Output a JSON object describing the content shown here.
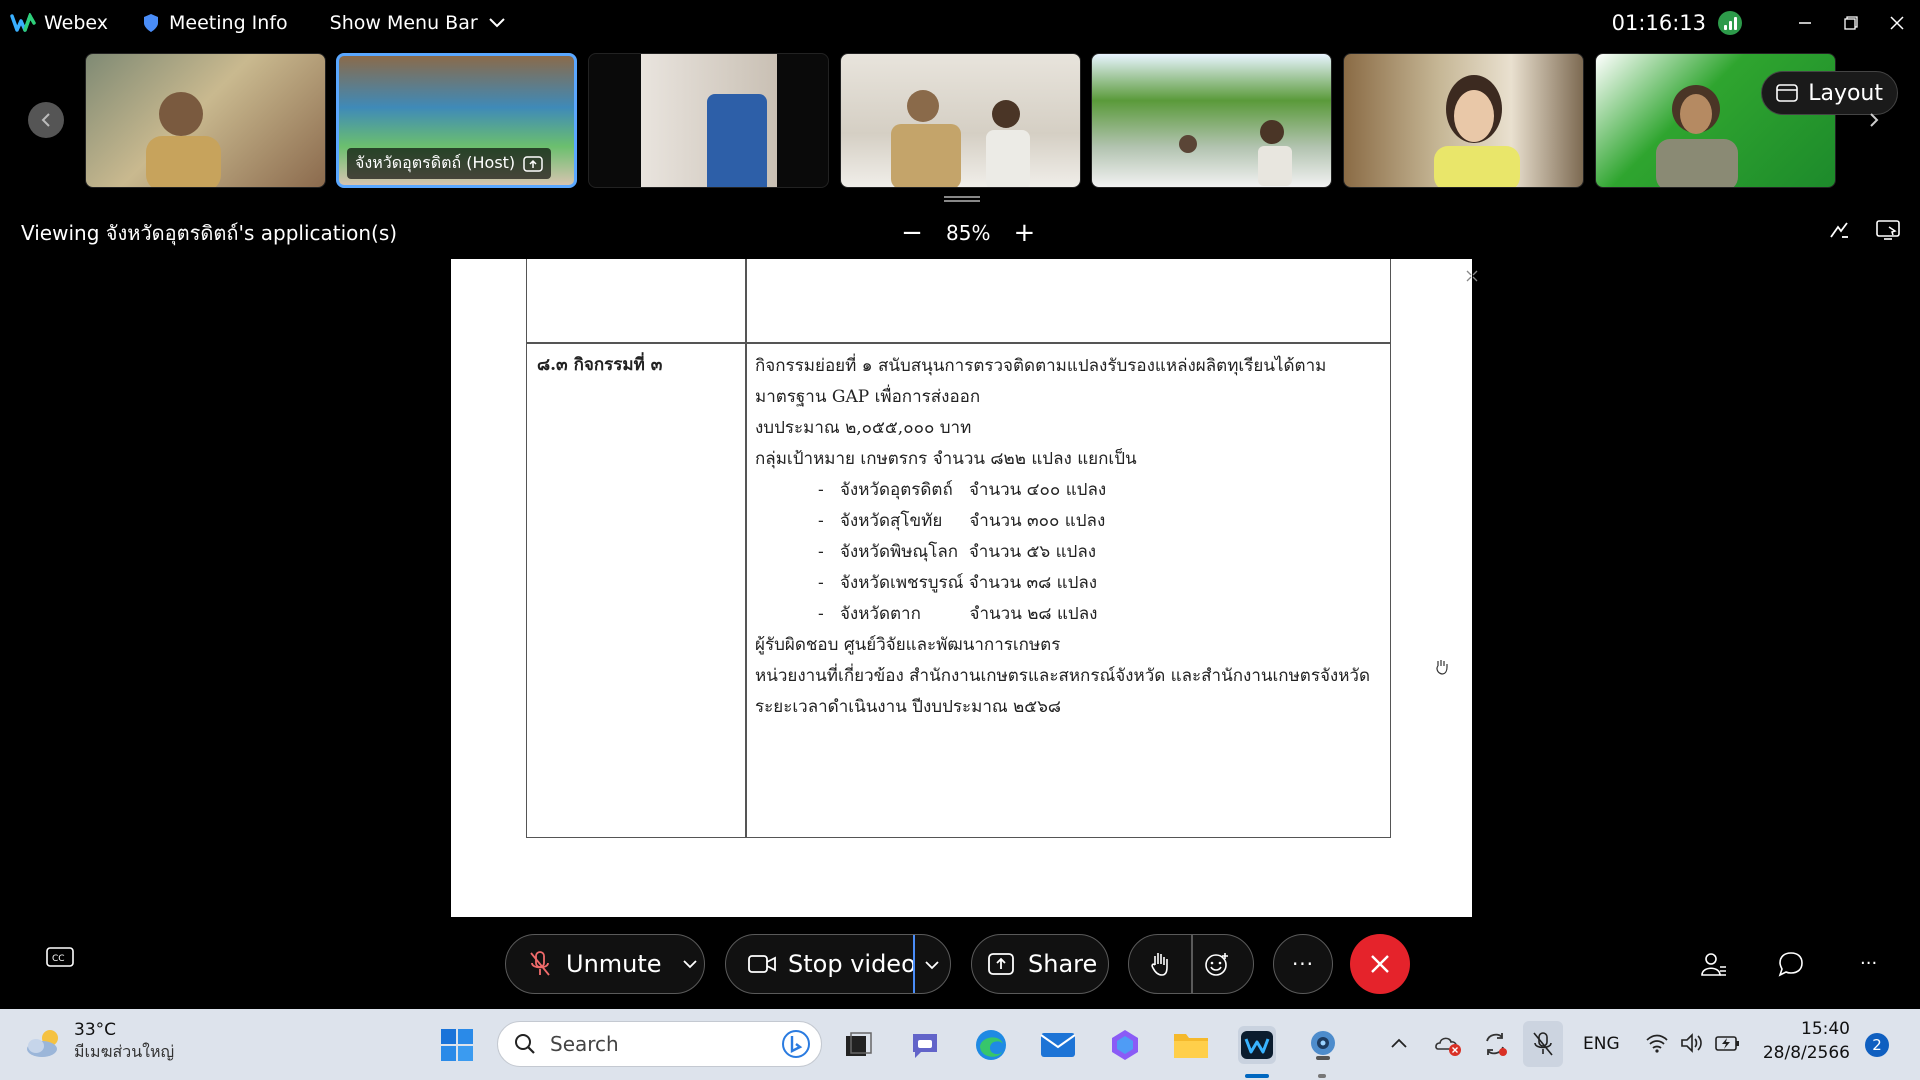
{
  "topbar": {
    "app_name": "Webex",
    "meeting_info": "Meeting Info",
    "show_menu_bar": "Show Menu Bar",
    "clock": "01:16:13"
  },
  "strip": {
    "host_label": "จังหวัดอุตรดิตถ์ (Host)",
    "layout_label": "Layout"
  },
  "viewbar": {
    "viewing_text": "Viewing จังหวัดอุตรดิตถ์'s application(s)",
    "zoom_minus": "−",
    "zoom_level": "85%",
    "zoom_plus": "+"
  },
  "document": {
    "left_cell": "๘.๓ กิจกรรมที่ ๓",
    "lines": [
      "กิจกรรมย่อยที่ ๑ สนับสนุนการตรวจติดตามแปลงรับรองแหล่งผลิตทุเรียนได้ตาม",
      "มาตรฐาน GAP เพื่อการส่งออก",
      "งบประมาณ  ๒,๐๕๕,๐๐๐  บาท",
      "กลุ่มเป้าหมาย เกษตรกร จำนวน ๘๒๒ แปลง แยกเป็น"
    ],
    "bullets": [
      "-   จังหวัดอุตรดิตถ์   จำนวน ๔๐๐ แปลง",
      "-   จังหวัดสุโขทัย     จำนวน ๓๐๐ แปลง",
      "-   จังหวัดพิษณุโลก  จำนวน ๕๖ แปลง",
      "-   จังหวัดเพชรบูรณ์ จำนวน ๓๘ แปลง",
      "-   จังหวัดตาก         จำนวน ๒๘ แปลง"
    ],
    "footer_lines": [
      "ผู้รับผิดชอบ ศูนย์วิจัยและพัฒนาการเกษตร",
      "หน่วยงานที่เกี่ยวข้อง สำนักงานเกษตรและสหกรณ์จังหวัด และสำนักงานเกษตรจังหวัด",
      "ระยะเวลาดำเนินงาน ปีงบประมาณ ๒๕๖๘"
    ]
  },
  "controls": {
    "unmute": "Unmute",
    "stop_video": "Stop video",
    "share": "Share",
    "more": "···",
    "right_more": "···"
  },
  "taskbar": {
    "temperature": "33°C",
    "weather_desc": "มีเมฆส่วนใหญ่",
    "search_placeholder": "Search",
    "language": "ENG",
    "time": "15:40",
    "date": "28/8/2566",
    "notifications": "2"
  },
  "colors": {
    "accent": "#5aa7ff",
    "end_call": "#e5232b",
    "taskbar_bg": "#dde3ec",
    "signal_green": "#2d9a4a"
  }
}
